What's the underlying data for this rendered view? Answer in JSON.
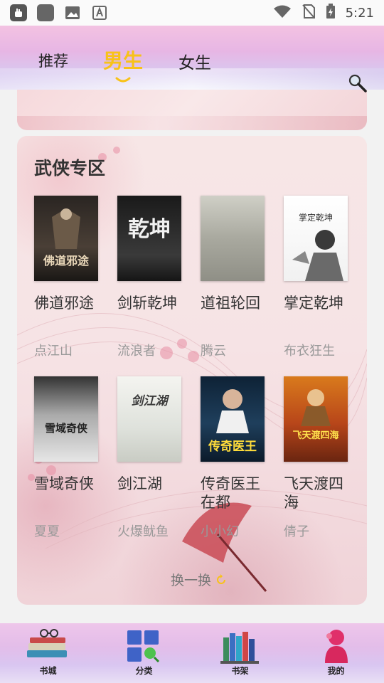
{
  "status_bar": {
    "time": "5:21"
  },
  "header": {
    "tabs": [
      {
        "label": "推荐"
      },
      {
        "label": "男生"
      },
      {
        "label": "女生"
      }
    ]
  },
  "section": {
    "title": "武侠专区",
    "books": [
      {
        "title": "佛道邪途",
        "author": "点江山",
        "cover_text": "佛道邪途"
      },
      {
        "title": "剑斩乾坤",
        "author": "流浪者",
        "cover_text": "乾坤"
      },
      {
        "title": "道祖轮回",
        "author": "腾云",
        "cover_text": ""
      },
      {
        "title": "掌定乾坤",
        "author": "布衣狂生",
        "cover_text": "掌定乾坤"
      },
      {
        "title": "雪域奇侠",
        "author": "夏夏",
        "cover_text": "雪域奇侠"
      },
      {
        "title": "剑江湖",
        "author": "火爆鱿鱼",
        "cover_text": "剑江湖"
      },
      {
        "title": "传奇医王在都",
        "author": "小小幻",
        "cover_text": "传奇医王"
      },
      {
        "title": "飞天渡四海",
        "author": "倩子",
        "cover_text": "飞天渡四海"
      }
    ],
    "refresh_label": "换一换"
  },
  "bottom_nav": [
    {
      "label": "书城"
    },
    {
      "label": "分类"
    },
    {
      "label": "书架"
    },
    {
      "label": "我的"
    }
  ],
  "colors": {
    "active_tab": "#f8c218",
    "section_title": "#333333",
    "author": "#999999"
  }
}
